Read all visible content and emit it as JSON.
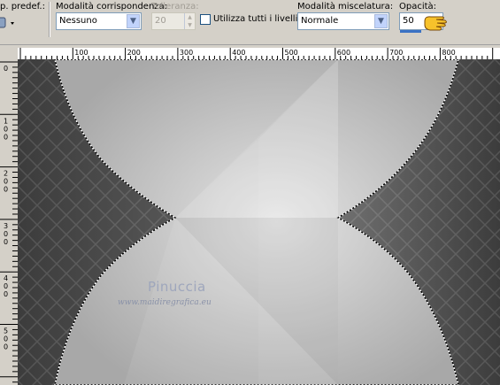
{
  "toolbar": {
    "preset_label": "p. predef.:",
    "match_mode": {
      "label": "Modalità corrispondenza:",
      "value": "Nessuno"
    },
    "tolerance": {
      "label": "Tolleranza:",
      "value": "20"
    },
    "use_all_layers": {
      "label": "Utilizza tutti i livelli",
      "checked": false
    },
    "blend_mode": {
      "label": "Modalità miscelatura:",
      "value": "Normale"
    },
    "opacity": {
      "label": "Opacità:",
      "value": "50"
    }
  },
  "ruler": {
    "h_ticks": [
      "100",
      "200",
      "300",
      "400",
      "500",
      "600",
      "700",
      "800"
    ],
    "v_ticks": [
      "0",
      "100",
      "200",
      "300",
      "400",
      "500"
    ]
  },
  "watermark": {
    "name": "Pinuccia",
    "url": "www.maidiregrafica.eu"
  },
  "colors": {
    "accent": "#3b72c4",
    "panel": "#d4d0c8",
    "canvas_dark": "#4a4a4a"
  }
}
